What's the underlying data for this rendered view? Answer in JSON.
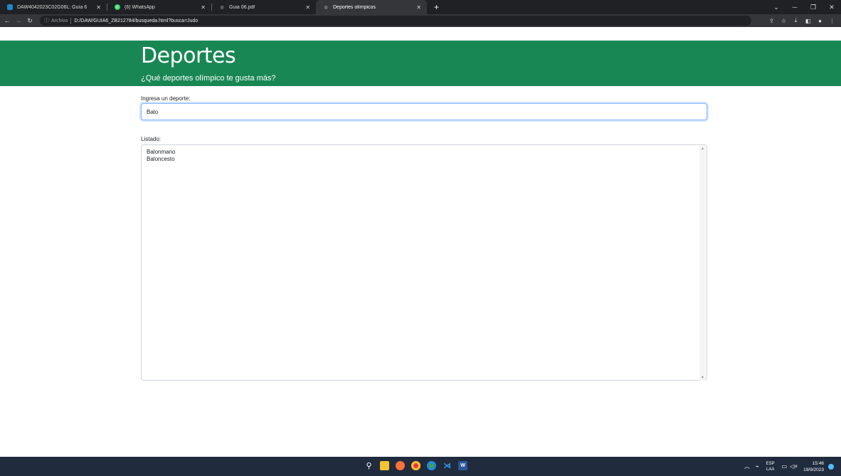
{
  "browser": {
    "tabs": [
      {
        "title": "DAW4042023C02G06L: Guía 6",
        "active": false
      },
      {
        "title": "(6) WhatsApp",
        "active": false
      },
      {
        "title": "Guia 06.pdf",
        "active": false
      },
      {
        "title": "Deportes olímpicos",
        "active": true
      }
    ],
    "new_tab": "+",
    "address": {
      "label": "Archivo",
      "url": "D:/DAW/GUIA6_ZB212784/busqueda.html?busca=Judo"
    }
  },
  "page": {
    "title": "Deportes",
    "subtitle": "¿Qué deportes olímpico te gusta más?",
    "search_label": "Ingresa un deporte:",
    "search_value": "Balo",
    "list_label": "Listado:",
    "list_items": [
      "Balonmano",
      "Baloncesto"
    ]
  },
  "taskbar": {
    "lang_top": "ESP",
    "lang_bottom": "LAA",
    "time": "15:46",
    "date": "19/9/2023"
  },
  "colors": {
    "header_bg": "#198754",
    "browser_frame": "#202124",
    "taskbar_bg": "#202b3d"
  }
}
